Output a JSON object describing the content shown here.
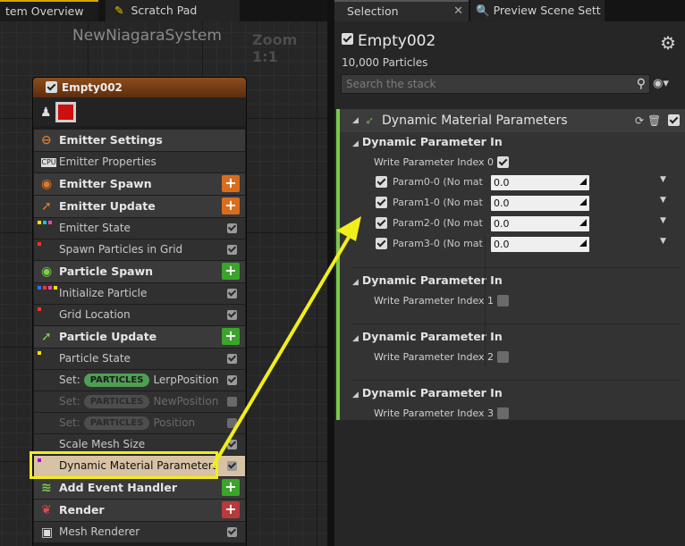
{
  "left_tabs": [
    {
      "label": "tem Overview",
      "icon": "system-overview-icon"
    },
    {
      "label": "Scratch Pad",
      "icon": "pencil-icon"
    }
  ],
  "graph": {
    "title": "NewNiagaraSystem",
    "zoom": "Zoom 1:1"
  },
  "emitter_node": {
    "title": "Empty002",
    "color": "#cc1010",
    "rows": [
      {
        "label": "Emitter Settings",
        "kind": "header",
        "icon": "emitter-settings-icon",
        "icon_color": "#e07a2a"
      },
      {
        "label": "Emitter Properties",
        "kind": "item",
        "icon": "cpu-icon"
      },
      {
        "label": "Emitter Spawn",
        "kind": "header",
        "icon": "emitter-spawn-icon",
        "icon_color": "#e07a2a",
        "button": "+",
        "button_color": "orange"
      },
      {
        "label": "Emitter Update",
        "kind": "header",
        "icon": "emitter-update-icon",
        "icon_color": "#e07a2a",
        "button": "+",
        "button_color": "orange"
      },
      {
        "label": "Emitter State",
        "kind": "item",
        "dots": [
          "#ffe000",
          "#00c8ff",
          "#ff40b0"
        ],
        "checked": true
      },
      {
        "label": "Spawn Particles in Grid",
        "kind": "item",
        "dots": [
          "#ff3030"
        ],
        "checked": true
      },
      {
        "label": "Particle Spawn",
        "kind": "header",
        "icon": "particle-spawn-icon",
        "icon_color": "#7ad14a",
        "button": "+",
        "button_color": "green"
      },
      {
        "label": "Initialize Particle",
        "kind": "item",
        "dots": [
          "#3070ff",
          "#ff3030",
          "#ff40b0",
          "#ffe000"
        ],
        "checked": true
      },
      {
        "label": "Grid Location",
        "kind": "item",
        "dots": [
          "#ff3030"
        ],
        "checked": true
      },
      {
        "label": "Particle Update",
        "kind": "header",
        "icon": "particle-update-icon",
        "icon_color": "#7ad14a",
        "button": "+",
        "button_color": "green"
      },
      {
        "label": "Particle State",
        "kind": "item",
        "dots": [
          "#ffe000"
        ],
        "checked": true
      },
      {
        "label": "LerpPosition",
        "kind": "set",
        "prefix": "Set:",
        "pill": "PARTICLES",
        "checked": true,
        "dim": false
      },
      {
        "label": "NewPosition",
        "kind": "set",
        "prefix": "Set:",
        "pill": "PARTICLES",
        "checked": false,
        "dim": true
      },
      {
        "label": "Position",
        "kind": "set",
        "prefix": "Set:",
        "pill": "PARTICLES",
        "checked": false,
        "dim": true
      },
      {
        "label": "Scale Mesh Size",
        "kind": "item",
        "checked": true
      },
      {
        "label": "Dynamic Material Parameters",
        "kind": "highlight",
        "dots": [
          "#b000d0"
        ],
        "checked": true
      },
      {
        "label": "Add Event Handler",
        "kind": "header",
        "icon": "event-handler-icon",
        "icon_color": "#7ad14a",
        "button": "+",
        "button_color": "green"
      },
      {
        "label": "Render",
        "kind": "header",
        "icon": "render-icon",
        "icon_color": "#e04848",
        "button": "+",
        "button_color": "red"
      },
      {
        "label": "Mesh Renderer",
        "kind": "item",
        "icon": "mesh-icon",
        "checked": true
      }
    ]
  },
  "right_tabs": [
    {
      "label": "Selection"
    },
    {
      "label": "Preview Scene Sett",
      "icon": "preview-scene-icon"
    }
  ],
  "selection": {
    "name": "Empty002",
    "particles": "10,000 Particles",
    "search_placeholder": "Search the stack"
  },
  "stack": {
    "title": "Dynamic Material Parameters",
    "sections": [
      {
        "title": "Dynamic Parameter In",
        "write_label": "Write Parameter Index 0",
        "write_checked": true,
        "params": [
          {
            "name": "Param0-0 (No mate",
            "value": "0.0"
          },
          {
            "name": "Param1-0 (No mate",
            "value": "0.0"
          },
          {
            "name": "Param2-0 (No mate",
            "value": "0.0"
          },
          {
            "name": "Param3-0 (No mate",
            "value": "0.0"
          }
        ]
      },
      {
        "title": "Dynamic Parameter In",
        "write_label": "Write Parameter Index 1",
        "write_checked": false
      },
      {
        "title": "Dynamic Parameter In",
        "write_label": "Write Parameter Index 2",
        "write_checked": false
      },
      {
        "title": "Dynamic Parameter In",
        "write_label": "Write Parameter Index 3",
        "write_checked": false
      }
    ]
  },
  "colors": {
    "annotation_yellow": "#f2ee1a",
    "stack_accent": "#78c94c",
    "emitter_header": "#8c4d1c"
  }
}
